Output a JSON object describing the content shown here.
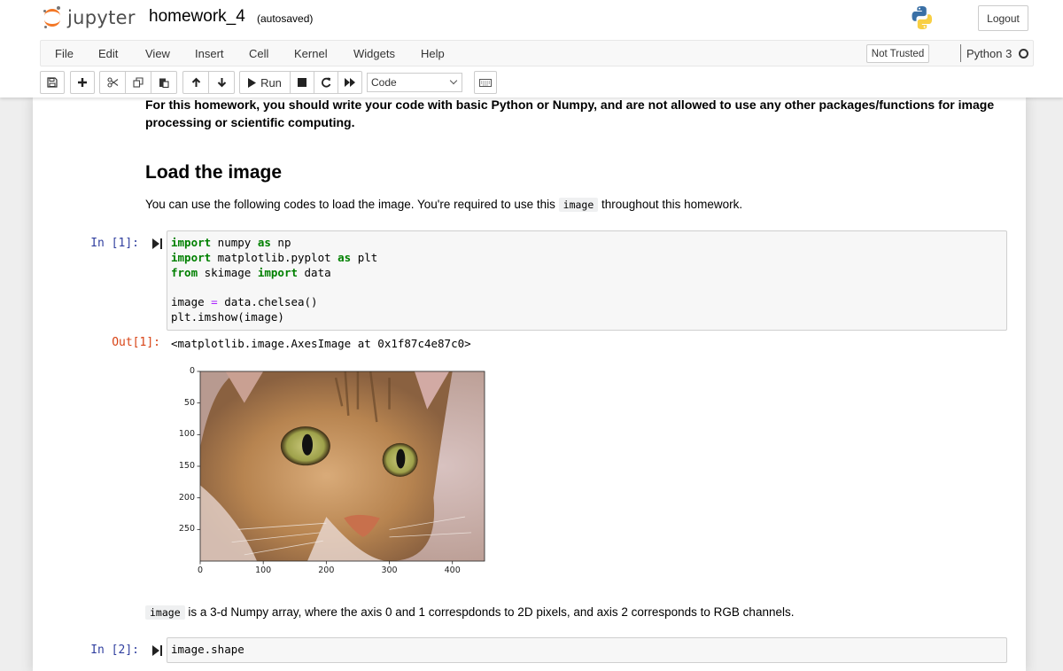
{
  "header": {
    "logo_text": "jupyter",
    "notebook_name": "homework_4",
    "autosave_status": "(autosaved)",
    "logout_label": "Logout"
  },
  "menubar": {
    "items": [
      "File",
      "Edit",
      "View",
      "Insert",
      "Cell",
      "Kernel",
      "Widgets",
      "Help"
    ],
    "trust_status": "Not Trusted",
    "kernel_name": "Python 3",
    "kernel_status_icon": "kernel-idle-circle-icon"
  },
  "toolbar": {
    "buttons": [
      {
        "name": "save",
        "icon": "floppy-disk-icon"
      },
      {
        "name": "insert-cell-below",
        "icon": "plus-icon"
      },
      {
        "name": "cut",
        "icon": "scissors-icon"
      },
      {
        "name": "copy",
        "icon": "copy-icon"
      },
      {
        "name": "paste",
        "icon": "paste-icon"
      },
      {
        "name": "move-up",
        "icon": "arrow-up-icon"
      },
      {
        "name": "move-down",
        "icon": "arrow-down-icon"
      },
      {
        "name": "run",
        "icon": "play-icon",
        "label": "Run"
      },
      {
        "name": "interrupt",
        "icon": "stop-square-icon"
      },
      {
        "name": "restart",
        "icon": "restart-icon"
      },
      {
        "name": "restart-run-all",
        "icon": "fast-forward-icon"
      },
      {
        "name": "command-palette",
        "icon": "keyboard-icon"
      }
    ],
    "run_label": "Run",
    "cell_type_selected": "Code"
  },
  "notebook": {
    "intro_line1": "For this homework, you should write your code with basic Python or Numpy, and are not allowed to use any other packages/functions for image",
    "intro_line2": "processing or scientific computing.",
    "section_heading": "Load the image",
    "load_text_before": "You can use the following codes to load the image. You're required to use this ",
    "load_text_code": "image",
    "load_text_after": " throughout this homework.",
    "cell1": {
      "prompt": "In [1]:",
      "lines": [
        [
          {
            "t": "import",
            "c": "kw"
          },
          {
            "t": " numpy "
          },
          {
            "t": "as",
            "c": "kw"
          },
          {
            "t": " np"
          }
        ],
        [
          {
            "t": "import",
            "c": "kw"
          },
          {
            "t": " matplotlib.pyplot "
          },
          {
            "t": "as",
            "c": "kw"
          },
          {
            "t": " plt"
          }
        ],
        [
          {
            "t": "from",
            "c": "kw"
          },
          {
            "t": " skimage "
          },
          {
            "t": "import",
            "c": "kw"
          },
          {
            "t": " data"
          }
        ],
        [],
        [
          {
            "t": "image "
          },
          {
            "t": "=",
            "c": "op"
          },
          {
            "t": " data.chelsea()"
          }
        ],
        [
          {
            "t": "plt.imshow(image)"
          }
        ]
      ],
      "out_prompt": "Out[1]:",
      "output_text": "<matplotlib.image.AxesImage at 0x1f87c4e87c0>"
    },
    "plot": {
      "content": "photo of a tabby cat face (skimage chelsea)",
      "x_ticks": [
        "0",
        "100",
        "200",
        "300",
        "400"
      ],
      "y_ticks": [
        "0",
        "50",
        "100",
        "150",
        "200",
        "250"
      ],
      "x_range": [
        0,
        451
      ],
      "y_range": [
        0,
        300
      ]
    },
    "shape_text_code": "image",
    "shape_text_after": " is a 3-d Numpy array, where the axis 0 and 1 correspdonds to 2D pixels, and axis 2 corresponds to RGB channels.",
    "cell2": {
      "prompt": "In [2]:",
      "code": "image.shape"
    }
  }
}
